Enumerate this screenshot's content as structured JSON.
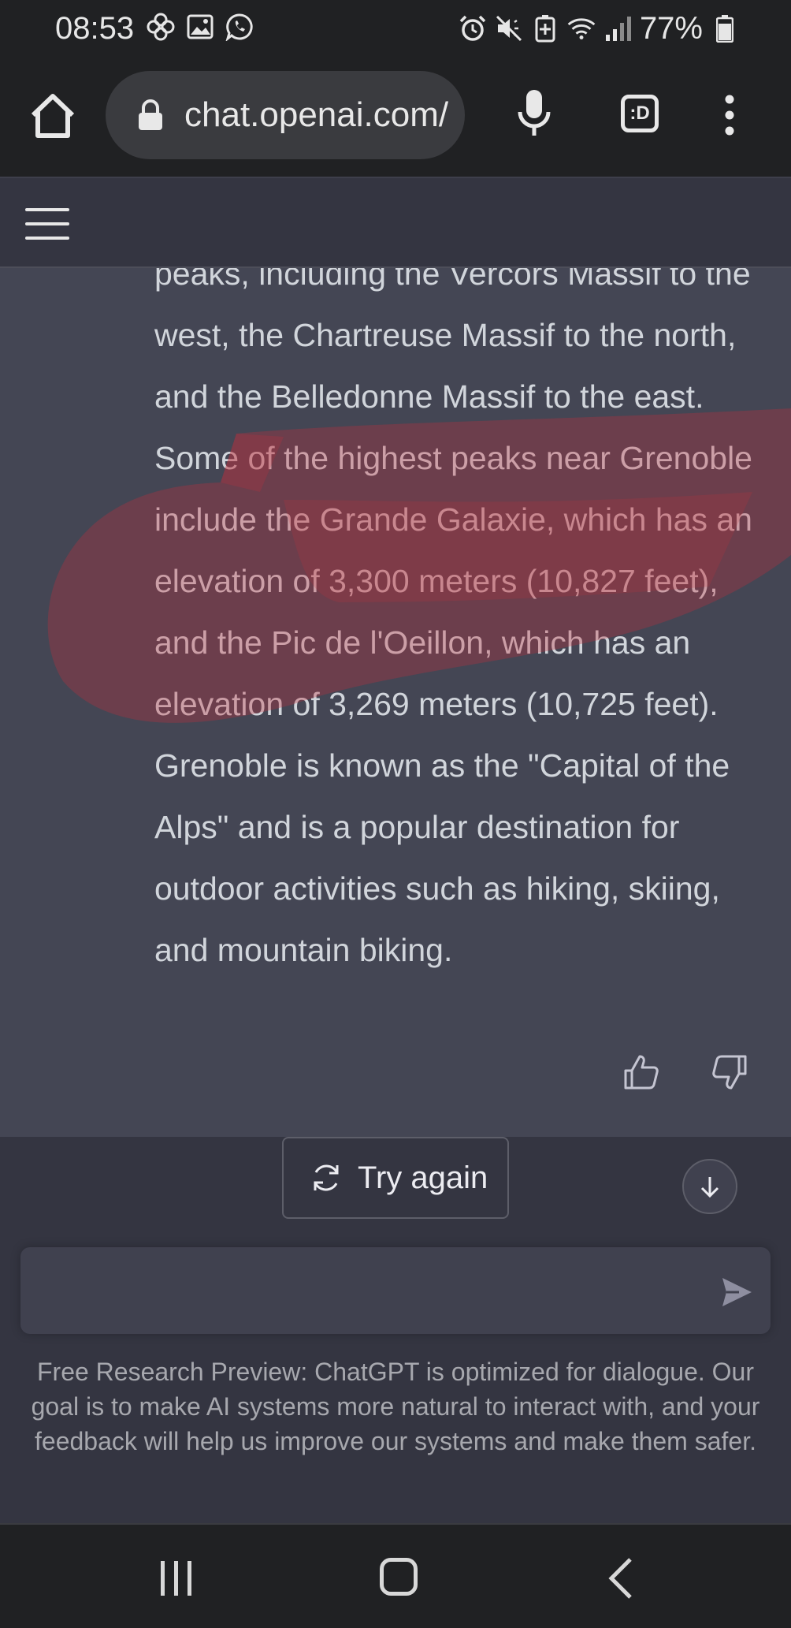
{
  "status_bar": {
    "time": "08:53",
    "battery": "77%",
    "left_icons": [
      "pinwheel-icon",
      "gallery-icon",
      "whatsapp-icon"
    ],
    "right_icons": [
      "alarm-icon",
      "mute-icon",
      "battery-saver-icon",
      "wifi-icon",
      "signal-icon",
      "battery-icon"
    ]
  },
  "browser": {
    "url": "chat.openai.com/",
    "tabs_label": ":D"
  },
  "conversation": {
    "answer_text": "peaks, including the Vercors Massif to the west, the Chartreuse Massif to the north, and the Belledonne Massif to the east. Some of the highest peaks near Grenoble include the Grande Galaxie, which has an elevation of 3,300 meters (10,827 feet), and the Pic de l'Oeillon, which has an elevation of 3,269 meters (10,725 feet). Grenoble is known as the \"Capital of the Alps\" and is a popular destination for outdoor activities such as hiking, skiing, and mountain biking."
  },
  "actions": {
    "try_again_label": "Try again"
  },
  "composer": {
    "input_value": "",
    "disclaimer": "Free Research Preview: ChatGPT is optimized for dialogue. Our goal is to make AI systems more natural to interact with, and your feedback will help us improve our systems and make them safer."
  },
  "colors": {
    "page_bg": "#202123",
    "header_bg": "#343541",
    "answer_bg": "#444654",
    "text": "#d1d5db",
    "scribble": "#c0303a"
  }
}
